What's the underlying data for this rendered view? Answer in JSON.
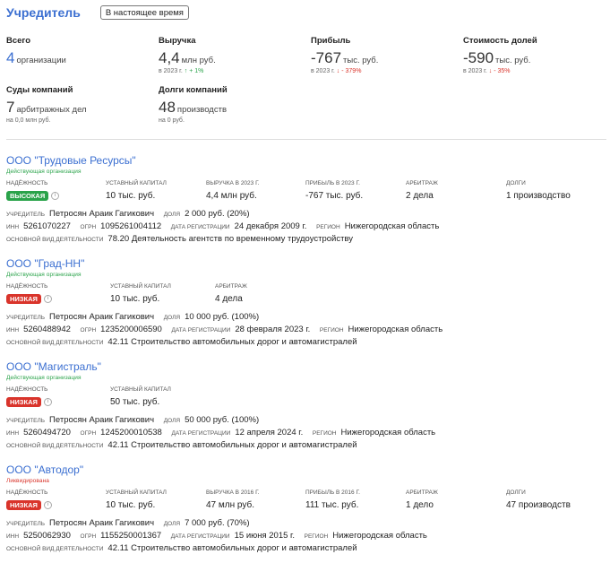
{
  "header": {
    "title": "Учредитель",
    "period_button": "В настоящее время"
  },
  "stats": {
    "total": {
      "label": "Всего",
      "value": "4",
      "unit": "организации"
    },
    "revenue": {
      "label": "Выручка",
      "value": "4,4",
      "unit": "млн руб.",
      "year": "в 2023 г.",
      "change_arrow": "↑",
      "change": "+ 1%"
    },
    "profit": {
      "label": "Прибыль",
      "value": "-767",
      "unit": "тыс. руб.",
      "year": "в 2023 г.",
      "change_arrow": "↓",
      "change": "- 379%"
    },
    "shares": {
      "label": "Стоимость долей",
      "value": "-590",
      "unit": "тыс. руб.",
      "year": "в 2023 г.",
      "change_arrow": "↓",
      "change": "- 35%"
    },
    "court": {
      "label": "Суды компаний",
      "value": "7",
      "unit": "арбитражных дел",
      "sub": "на 0,0 млн руб."
    },
    "debts": {
      "label": "Долги компаний",
      "value": "48",
      "unit": "производств",
      "sub": "на 0 руб."
    }
  },
  "labels": {
    "reliability": "Надёжность",
    "capital": "Уставный капитал",
    "arbitrage": "Арбитраж",
    "debts": "Долги",
    "founder": "Учредитель",
    "share": "Доля",
    "inn": "ИНН",
    "ogrn": "ОГРН",
    "reg_date": "Дата регистрации",
    "region": "Регион",
    "activity": "Основной вид деятельности",
    "info": "i"
  },
  "companies": [
    {
      "name": "ООО \"Трудовые Ресурсы\"",
      "status": "Действующая организация",
      "reliability": "ВЫСОКАЯ",
      "capital": "10 тыс. руб.",
      "revenue_label": "Выручка в 2023 г.",
      "revenue": "4,4 млн руб.",
      "profit_label": "Прибыль в 2023 г.",
      "profit": "-767 тыс. руб.",
      "arbitrage": "2 дела",
      "debts": "1 производство",
      "founder": "Петросян Араик Гагикович",
      "share": "2 000 руб. (20%)",
      "inn": "5261070227",
      "ogrn": "1095261004112",
      "reg_date": "24 декабря 2009 г.",
      "region": "Нижегородская область",
      "activity": "78.20 Деятельность агентств по временному трудоустройству"
    },
    {
      "name": "ООО \"Град-НН\"",
      "status": "Действующая организация",
      "reliability": "НИЗКАЯ",
      "capital": "10 тыс. руб.",
      "arbitrage": "4 дела",
      "founder": "Петросян Араик Гагикович",
      "share": "10 000 руб. (100%)",
      "inn": "5260488942",
      "ogrn": "1235200006590",
      "reg_date": "28 февраля 2023 г.",
      "region": "Нижегородская область",
      "activity": "42.11 Строительство автомобильных дорог и автомагистралей"
    },
    {
      "name": "ООО \"Магистраль\"",
      "status": "Действующая организация",
      "reliability": "НИЗКАЯ",
      "capital": "50 тыс. руб.",
      "founder": "Петросян Араик Гагикович",
      "share": "50 000 руб. (100%)",
      "inn": "5260494720",
      "ogrn": "1245200010538",
      "reg_date": "12 апреля 2024 г.",
      "region": "Нижегородская область",
      "activity": "42.11 Строительство автомобильных дорог и автомагистралей"
    },
    {
      "name": "ООО \"Автодор\"",
      "status": "Ликвидирована",
      "reliability": "НИЗКАЯ",
      "capital": "10 тыс. руб.",
      "revenue_label": "Выручка в 2016 г.",
      "revenue": "47 млн руб.",
      "profit_label": "Прибыль в 2016 г.",
      "profit": "111 тыс. руб.",
      "arbitrage": "1 дело",
      "debts": "47 производств",
      "founder": "Петросян Араик Гагикович",
      "share": "7 000 руб. (70%)",
      "inn": "5250062930",
      "ogrn": "1155250001367",
      "reg_date": "15 июня 2015 г.",
      "region": "Нижегородская область",
      "activity": "42.11 Строительство автомобильных дорог и автомагистралей"
    }
  ]
}
